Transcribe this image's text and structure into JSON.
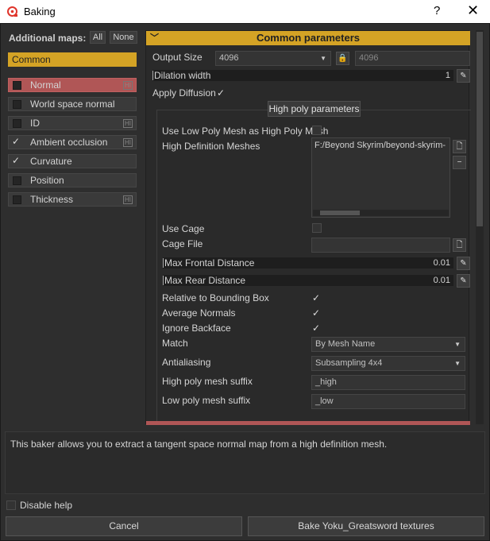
{
  "window": {
    "title": "Baking",
    "help_label": "?",
    "close_label": "✕"
  },
  "left": {
    "additional_maps_label": "Additional maps:",
    "all_label": "All",
    "none_label": "None",
    "common_label": "Common",
    "maps": [
      {
        "label": "Normal",
        "checked": false,
        "hi": "HI"
      },
      {
        "label": "World space normal",
        "checked": false,
        "hi": ""
      },
      {
        "label": "ID",
        "checked": false,
        "hi": "HI"
      },
      {
        "label": "Ambient occlusion",
        "checked": true,
        "hi": "HI"
      },
      {
        "label": "Curvature",
        "checked": true,
        "hi": ""
      },
      {
        "label": "Position",
        "checked": false,
        "hi": ""
      },
      {
        "label": "Thickness",
        "checked": false,
        "hi": "HI"
      }
    ]
  },
  "common": {
    "header": "Common parameters",
    "output_size_label": "Output Size",
    "output_size_value": "4096",
    "output_size_value2": "4096",
    "dilation_label": "Dilation width",
    "dilation_value": "1",
    "apply_diffusion_label": "Apply Diffusion",
    "check_mark": "✓"
  },
  "high_poly": {
    "header": "High poly parameters",
    "use_low_poly_label": "Use Low Poly Mesh as High Poly Mesh",
    "high_def_label": "High Definition Meshes",
    "high_def_value": "F:/Beyond Skyrim/beyond-skyrim-",
    "use_cage_label": "Use Cage",
    "cage_file_label": "Cage File",
    "max_frontal_label": "Max Frontal Distance",
    "max_frontal_value": "0.01",
    "max_rear_label": "Max Rear Distance",
    "max_rear_value": "0.01",
    "relative_bbox_label": "Relative to Bounding Box",
    "average_normals_label": "Average Normals",
    "ignore_backface_label": "Ignore Backface",
    "match_label": "Match",
    "match_value": "By Mesh Name",
    "antialiasing_label": "Antialiasing",
    "antialiasing_value": "Subsampling 4x4",
    "high_suffix_label": "High poly mesh suffix",
    "high_suffix_value": "_high",
    "low_suffix_label": "Low poly mesh suffix",
    "low_suffix_value": "_low"
  },
  "help": {
    "text": "This baker allows you to extract a tangent space normal map from a high definition mesh.",
    "disable_label": "Disable help"
  },
  "buttons": {
    "cancel": "Cancel",
    "bake": "Bake Yoku_Greatsword textures"
  }
}
